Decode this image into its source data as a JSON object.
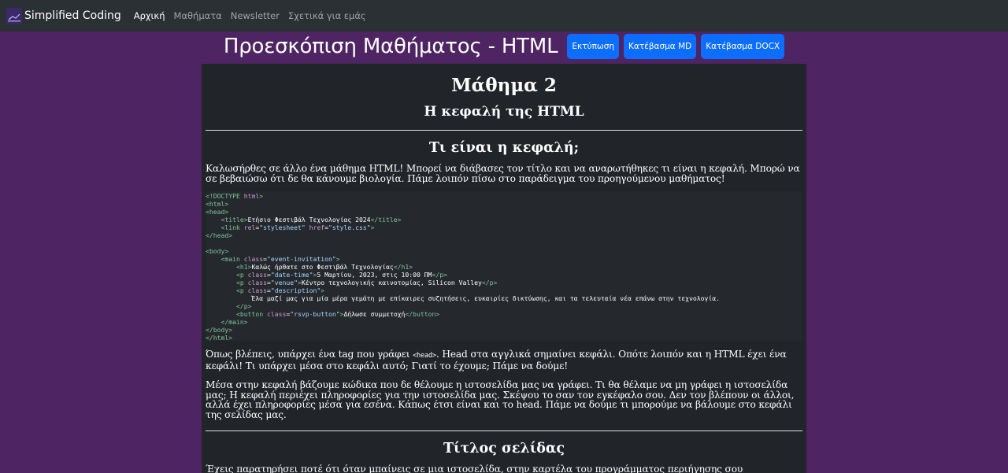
{
  "navbar": {
    "brand": "Simplified Coding",
    "links": [
      {
        "label": "Αρχική",
        "active": true
      },
      {
        "label": "Μαθήματα",
        "active": false
      },
      {
        "label": "Newsletter",
        "active": false
      },
      {
        "label": "Σχετικά για εμάς",
        "active": false
      }
    ]
  },
  "header": {
    "title": "Προεσκόπιση Μαθήματος - HTML",
    "buttons": {
      "print": "Εκτύπωση",
      "download_md": "Κατέβασμα MD",
      "download_docx": "Κατέβασμα DOCX"
    }
  },
  "lesson": {
    "number": "Μάθημα 2",
    "subtitle": "Η κεφαλή της HTML",
    "section1_title": "Τι είναι η κεφαλή;",
    "intro": "Καλωσήρθες σε άλλο ένα μάθημα HTML! Μπορεί να διάβασες τον τίτλο και να αναρωτήθηκες τι είναι η κεφαλή. Μπορώ να σε βεβαιώσω ότι δε θα κάνουμε βιολογία. Πάμε λοιπόν πίσω στο παράδειγμα του προηγούμενου μαθήματος!",
    "code": {
      "title_text": "Ετήσιο Φεστιβάλ Τεχνολογίας 2024",
      "stylesheet": "\"stylesheet\"",
      "href": "\"style.css\"",
      "main_class": "\"event-invitation\"",
      "h1_text": "Καλώς ήρθατε στο Φεστιβάλ Τεχνολογίας",
      "datetime_class": "\"date-time\"",
      "datetime_text": "5 Μαρτίου, 2023, στις 10:00 ΠΜ",
      "venue_class": "\"venue\"",
      "venue_text": "Κέντρο τεχνολογικής καινοτομίας, Silicon Valley",
      "desc_class": "\"description\"",
      "desc_text": "Έλα μαζί μας για μία μέρα γεμάτη με επίκαιρες συζητήσεις, ευκαιρίες δικτύωσης, και τα τελευταία νέα επάνω στην τεχνολογία.",
      "button_class": "\"rsvp-button\"",
      "button_text": "Δήλωσε συμμετοχή"
    },
    "para2_before": "Όπως βλέπεις, υπάρχει ένα tag που γράφει ",
    "para2_code": "<head>",
    "para2_after": ". Head στα αγγλικά σημαίνει κεφάλι. Οπότε λοιπόν και η HTML έχει ένα κεφάλι! Τι υπάρχει μέσα στο κεφάλι αυτό; Γιατί το έχουμε; Πάμε να δούμε!",
    "para3": "Μέσα στην κεφαλή βάζουμε κώδικα που δε θέλουμε η ιστοσελίδα μας να γράφει. Τι θα θέλαμε να μη γράφει η ιστοσελίδα μας; Η κεφαλή περιέχει πληροφορίες για την ιστοσελίδα μας. Σκέψου το σαν τον εγκέφαλο σου. Δεν τον βλέπουν οι άλλοι, αλλά έχει πληροφορίες μέσα για εσένα. Κάπως έτσι είναι και το head. Πάμε να δούμε τι μπορούμε να βάλουμε στο κεφάλι της σελίδας μας.",
    "section2_title": "Τίτλος σελίδας",
    "para4": "Έχεις παρατηρήσει ποτέ ότι όταν μπαίνεις σε μια ιστοσελίδα, στην καρτέλα του προγράμματος περιήγησης σου εμφανίζεται ένας τίτλος;"
  },
  "colors": {
    "background": "#4f2463",
    "navbar": "#2b3035",
    "card": "#212529",
    "button": "#0d6efd",
    "code_tag": "#7ec699",
    "code_attr": "#cc99cd"
  }
}
